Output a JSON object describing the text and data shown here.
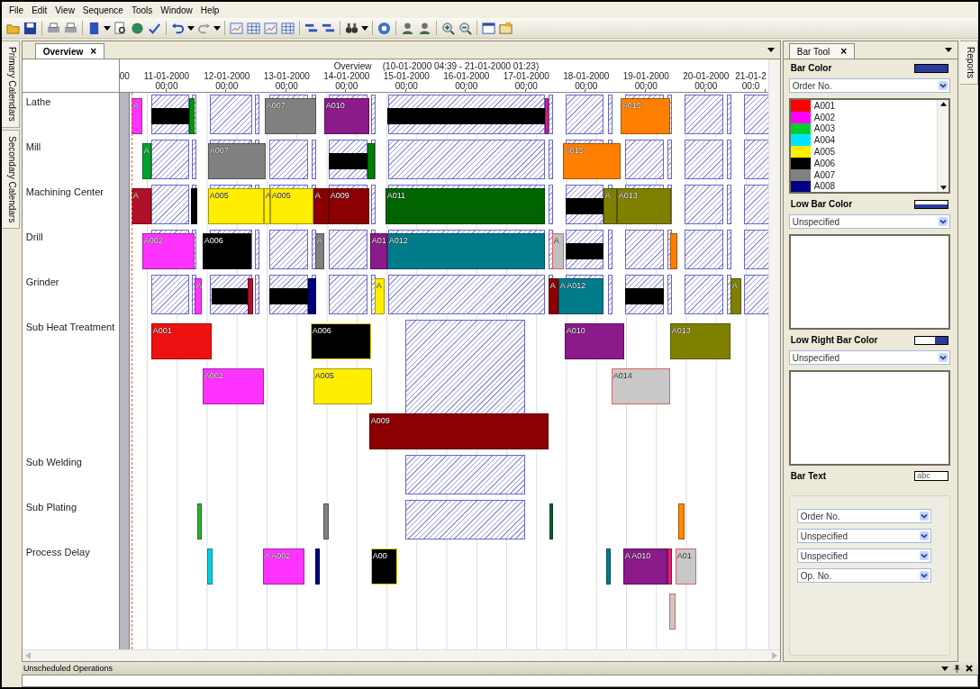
{
  "menu": [
    "File",
    "Edit",
    "View",
    "Sequence",
    "Tools",
    "Window",
    "Help"
  ],
  "side_tabs": [
    {
      "label": "Primary Calendars",
      "selected": false
    },
    {
      "label": "Secondary Calendars",
      "selected": false
    }
  ],
  "document_tab": {
    "label": "Overview",
    "close": "×"
  },
  "timeline": {
    "title": "Overview",
    "range": "(10-01-2000 04:39 - 21-01-2000 01:23)",
    "clipped_time": "00",
    "ticks": [
      {
        "date": "11-01-2000",
        "time": "00:00"
      },
      {
        "date": "12-01-2000",
        "time": "00:00"
      },
      {
        "date": "13-01-2000",
        "time": "00:00"
      },
      {
        "date": "14-01-2000",
        "time": "00:00"
      },
      {
        "date": "15-01-2000",
        "time": "00:00"
      },
      {
        "date": "16-01-2000",
        "time": "00:00"
      },
      {
        "date": "17-01-2000",
        "time": "00:00"
      },
      {
        "date": "18-01-2000",
        "time": "00:00"
      },
      {
        "date": "19-01-2000",
        "time": "00:00"
      },
      {
        "date": "20-01-2000",
        "time": "00:00"
      },
      {
        "date": "21-01-2",
        "time": "00:0"
      }
    ]
  },
  "rows": [
    {
      "label": "Lathe",
      "kind": "machine",
      "lanes": [
        {
          "bars": [
            {
              "kind": "block",
              "label": "A",
              "color": "#ff33ff"
            },
            {
              "kind": "band",
              "color": "#000000"
            },
            {
              "kind": "block",
              "color": "#009900"
            },
            {
              "kind": "block",
              "label": "A007",
              "color": "#808080"
            },
            {
              "kind": "block",
              "label": "A010",
              "color": "#8b1a8b"
            },
            {
              "kind": "band",
              "color": "#000000"
            },
            {
              "kind": "block",
              "color": "#e0207a"
            },
            {
              "kind": "block",
              "label": "A015",
              "color": "#ff8000"
            }
          ]
        }
      ]
    },
    {
      "label": "Mill",
      "kind": "machine",
      "lanes": [
        {
          "bars": [
            {
              "kind": "block",
              "label": "A",
              "color": "#00a030"
            },
            {
              "kind": "block",
              "label": "A007",
              "color": "#808080"
            },
            {
              "kind": "band",
              "color": "#000000"
            },
            {
              "kind": "block",
              "color": "#008000"
            },
            {
              "kind": "block",
              "label": "A015",
              "color": "#ff8000"
            }
          ]
        }
      ]
    },
    {
      "label": "Machining Center",
      "kind": "machine",
      "lanes": [
        {
          "bars": [
            {
              "kind": "block",
              "label": "A",
              "color": "#b0102a"
            },
            {
              "kind": "block",
              "color": "#000000"
            },
            {
              "kind": "block",
              "label": "A005",
              "color": "#ffee00"
            },
            {
              "kind": "block",
              "label": "A",
              "color": "#ffee00"
            },
            {
              "kind": "block",
              "label": "A005",
              "color": "#ffee00"
            },
            {
              "kind": "block",
              "label": "A",
              "color": "#8b0000"
            },
            {
              "kind": "block",
              "label": "A009",
              "color": "#8b0000"
            },
            {
              "kind": "block",
              "label": "A011",
              "color": "#006400"
            },
            {
              "kind": "band",
              "color": "#000000"
            },
            {
              "kind": "block",
              "label": "A",
              "color": "#808000"
            },
            {
              "kind": "block",
              "label": "A013",
              "color": "#808000"
            }
          ]
        }
      ]
    },
    {
      "label": "Drill",
      "kind": "machine",
      "lanes": [
        {
          "bars": [
            {
              "kind": "block",
              "label": "A002",
              "color": "#ff33ff"
            },
            {
              "kind": "block",
              "label": "A006",
              "color": "#000000"
            },
            {
              "kind": "block",
              "label": "A",
              "color": "#808080"
            },
            {
              "kind": "block",
              "label": "A01",
              "color": "#8b1a8b"
            },
            {
              "kind": "block",
              "label": "A012",
              "color": "#007b8a"
            },
            {
              "kind": "block",
              "label": "A",
              "color": "#c0c0c0",
              "outlined": true
            },
            {
              "kind": "band",
              "color": "#000000"
            },
            {
              "kind": "block",
              "color": "#ff8000"
            }
          ]
        }
      ]
    },
    {
      "label": "Grinder",
      "kind": "machine",
      "lanes": [
        {
          "bars": [
            {
              "kind": "block",
              "label": "A",
              "color": "#ff33ff"
            },
            {
              "kind": "band",
              "color": "#000000"
            },
            {
              "kind": "block",
              "color": "#b0102a"
            },
            {
              "kind": "band",
              "color": "#000000"
            },
            {
              "kind": "block",
              "color": "#000080"
            },
            {
              "kind": "block",
              "label": "A",
              "color": "#ffee00"
            },
            {
              "kind": "block",
              "label": "A",
              "color": "#8b0000"
            },
            {
              "kind": "block",
              "label": "A A012",
              "color": "#007b8a"
            },
            {
              "kind": "band",
              "color": "#000000"
            },
            {
              "kind": "block",
              "label": "A",
              "color": "#808000"
            }
          ]
        }
      ]
    },
    {
      "label": "Sub Heat Treatment",
      "kind": "subcontract",
      "lanes": [
        {
          "bars": [
            {
              "kind": "block",
              "label": "A001",
              "color": "#ee1111"
            },
            {
              "kind": "block",
              "label": "A006",
              "color": "#000000",
              "outlined": true
            },
            {
              "kind": "block",
              "label": "A010",
              "color": "#8b1a8b"
            },
            {
              "kind": "block",
              "label": "A013",
              "color": "#808000"
            }
          ]
        },
        {
          "bars": [
            {
              "kind": "block",
              "label": "A002",
              "color": "#ff33ff"
            },
            {
              "kind": "block",
              "label": "A005",
              "color": "#ffee00"
            },
            {
              "kind": "block",
              "label": "A014",
              "color": "#c8c8c8",
              "outlined": true
            }
          ]
        },
        {
          "bars": [
            {
              "kind": "block",
              "label": "A009",
              "color": "#8b0000"
            }
          ]
        }
      ]
    },
    {
      "label": "Sub Welding",
      "kind": "subcontract"
    },
    {
      "label": "Sub Plating",
      "kind": "subcontract",
      "lanes": [
        {
          "bars": [
            {
              "kind": "block",
              "color": "#30b030"
            },
            {
              "kind": "block",
              "color": "#808080"
            },
            {
              "kind": "block",
              "color": "#006030"
            },
            {
              "kind": "block",
              "color": "#ff8800"
            }
          ]
        }
      ]
    },
    {
      "label": "Process Delay",
      "kind": "delay",
      "lanes": [
        {
          "bars": [
            {
              "kind": "block",
              "color": "#00d0e0"
            },
            {
              "kind": "block",
              "label": "A A002",
              "color": "#ff33ff"
            },
            {
              "kind": "block",
              "color": "#000080"
            },
            {
              "kind": "block",
              "label": "A00",
              "color": "#000000",
              "outlined": true
            },
            {
              "kind": "block",
              "color": "#007b8a"
            },
            {
              "kind": "block",
              "label": "A A010",
              "color": "#8b1a8b"
            },
            {
              "kind": "block",
              "color": "#e0207a"
            },
            {
              "kind": "block",
              "label": "A01",
              "color": "#c8c8c8",
              "outlined": true
            }
          ]
        },
        {
          "bars": [
            {
              "kind": "block",
              "color": "#c8c8c8",
              "outlined": true
            }
          ]
        }
      ]
    }
  ],
  "bar_tool": {
    "tab": "Bar Tool",
    "close": "×",
    "bar_color": {
      "label": "Bar Color",
      "select": "Order No.",
      "legend": [
        {
          "name": "A001",
          "color": "#ff0000"
        },
        {
          "name": "A002",
          "color": "#ff00ff"
        },
        {
          "name": "A003",
          "color": "#00cc33"
        },
        {
          "name": "A004",
          "color": "#00e5ff"
        },
        {
          "name": "A005",
          "color": "#ffee00"
        },
        {
          "name": "A006",
          "color": "#000000"
        },
        {
          "name": "A007",
          "color": "#808080"
        },
        {
          "name": "A008",
          "color": "#000080"
        }
      ]
    },
    "low_bar_color": {
      "label": "Low Bar Color",
      "select": "Unspecified"
    },
    "low_right_bar_color": {
      "label": "Low Right Bar Color",
      "select": "Unspecified"
    },
    "bar_text": {
      "label": "Bar Text",
      "sample": "abc",
      "selects": [
        "Order No.",
        "Unspecified",
        "Unspecified",
        "Op. No."
      ]
    }
  },
  "right_tab": {
    "label": "Reports",
    "selected": false
  },
  "bottom_panel": {
    "title": "Unscheduled Operations"
  }
}
